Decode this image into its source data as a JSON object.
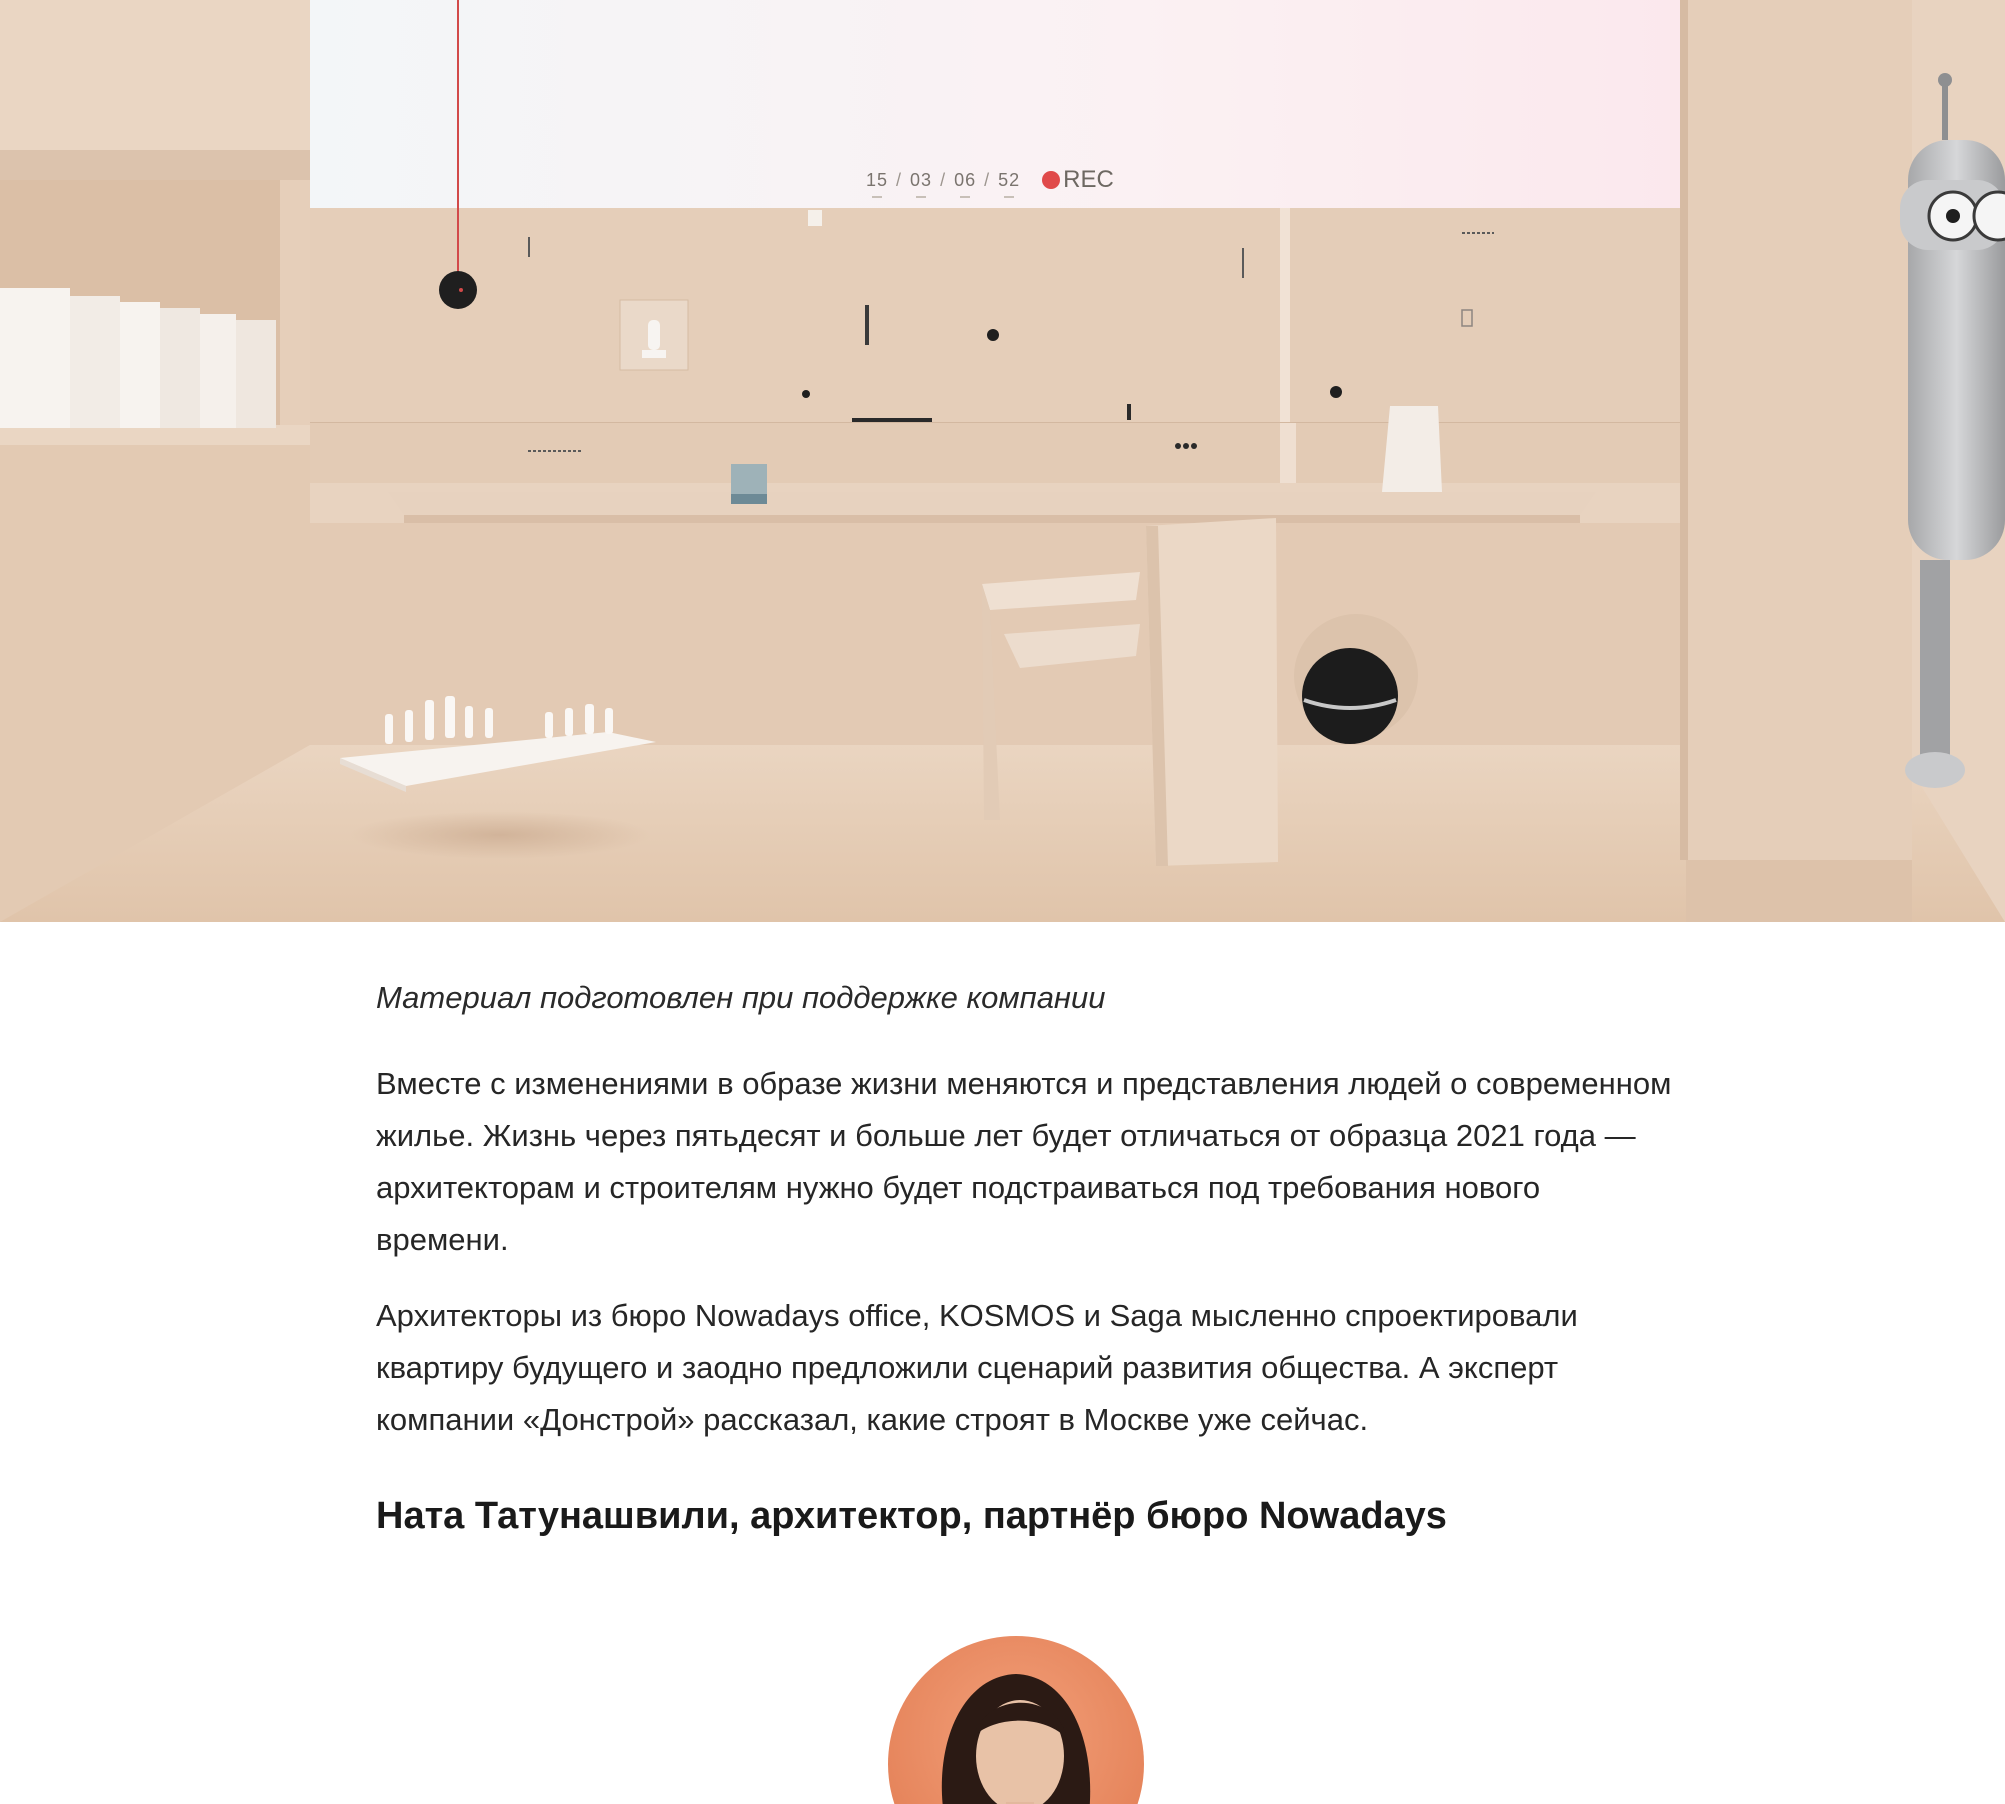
{
  "hero": {
    "hud": {
      "time_values": [
        "15",
        "03",
        "06",
        "52"
      ],
      "separator": "/",
      "rec_label": "REC"
    },
    "colors": {
      "wall": "#ead7c5",
      "floor": "#e2c8b0",
      "rec_dot": "#e04a4a"
    }
  },
  "article": {
    "sponsor_note": "Материал подготовлен при поддержке компании",
    "paragraphs": [
      "Вместе с изменениями в образе жизни меняются и представления людей о современном жилье. Жизнь через пятьдесят и больше лет будет отличаться от образца 2021 года — архитекторам и строителям нужно будет подстраиваться под требования нового времени.",
      "Архитекторы из бюро Nowadays office, KOSMOS и Saga мысленно спроектировали квартиру будущего и заодно предложили сценарий развития общества. А эксперт компании «Донстрой» рассказал, какие строят в Москве уже сейчас."
    ],
    "subheading": "Ната Татунашвили, архитектор, партнёр бюро Nowadays"
  }
}
